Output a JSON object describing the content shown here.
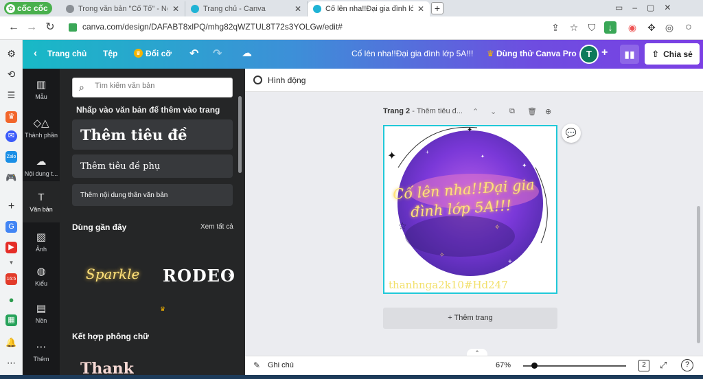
{
  "browser": {
    "logo": "cốc cốc",
    "tabs": [
      {
        "label": "Trong văn bản \"Cố Tố\" - Ngu"
      },
      {
        "label": "Trang chủ - Canva"
      },
      {
        "label": "Cố lên nha!!Đại gia đình lớp"
      }
    ],
    "new_tab": "+",
    "url": "canva.com/design/DAFABT8xlPQ/mhg82qWZTUL8T72s3YOLGw/edit#"
  },
  "header": {
    "home": "Trang chủ",
    "file": "Tệp",
    "resize": "Đổi cỡ",
    "doc_title": "Cố lên nha!!Đại gia đình lớp 5A!!!",
    "try_pro": "Dùng thử Canva Pro",
    "avatar": "T",
    "share": "Chia sẻ"
  },
  "rail": [
    {
      "label": "Mẫu",
      "icon": "template-icon"
    },
    {
      "label": "Thành phần",
      "icon": "elements-icon"
    },
    {
      "label": "Nội dung t...",
      "icon": "upload-icon"
    },
    {
      "label": "Văn bản",
      "icon": "text-icon"
    },
    {
      "label": "Ảnh",
      "icon": "photo-icon"
    },
    {
      "label": "Kiểu",
      "icon": "styles-icon"
    },
    {
      "label": "Nền",
      "icon": "background-icon"
    },
    {
      "label": "Thêm",
      "icon": "more-icon"
    }
  ],
  "panel": {
    "search_placeholder": "Tìm kiếm văn bản",
    "hint": "Nhấp vào văn bản để thêm vào trang",
    "heading": "Thêm tiêu đề",
    "subheading": "Thêm tiêu đề phụ",
    "body": "Thêm nội dung thân văn bản",
    "recent": "Dùng gần đây",
    "see_all": "Xem tất cả",
    "font1": "Sparkle",
    "font2": "RODEO",
    "combos": "Kết hợp phông chữ",
    "combo_preview": "Thank"
  },
  "editor": {
    "animate": "Hình động",
    "page_label": "Trang 2",
    "page_title": "Thêm tiêu đ...",
    "design_text_1": "Cố lên nha!!Đại gia",
    "design_text_2": "đình lớp 5A!!!",
    "watermark": "thanhnga2k10#Hd247",
    "add_page": "+ Thêm trang",
    "notes": "Ghi chú",
    "zoom": "67%",
    "page_count": "2"
  },
  "colors": {
    "accent_gradient_start": "#18b9c6",
    "accent_gradient_end": "#7b3fe4",
    "selection": "#1fc8d8",
    "panel_bg": "#252627"
  }
}
